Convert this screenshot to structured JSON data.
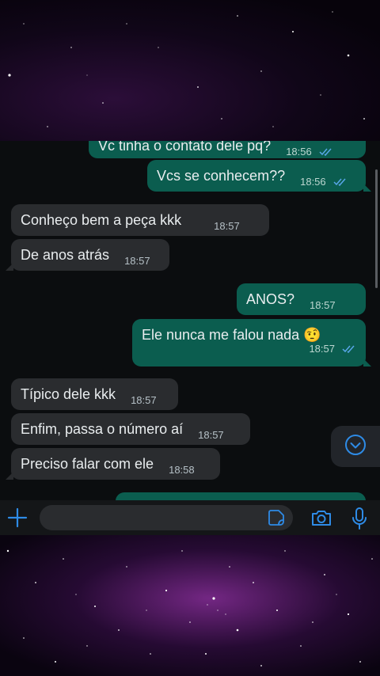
{
  "colors": {
    "incoming_bubble": "#2a2c2f",
    "outgoing_bubble": "#0b5d4f",
    "chat_background": "#0b0d0f",
    "accent": "#2e8be6",
    "read_ticks": "#58a6e8"
  },
  "messages": [
    {
      "direction": "out",
      "text": "Vc tinha o contato dele pq?",
      "time": "18:56",
      "status": "read"
    },
    {
      "direction": "out",
      "text": "Vcs se conhecem??",
      "time": "18:56",
      "status": "read"
    },
    {
      "direction": "in",
      "text": "Conheço bem a peça kkk",
      "time": "18:57"
    },
    {
      "direction": "in",
      "text": "De anos atrás",
      "time": "18:57"
    },
    {
      "direction": "out",
      "text": "ANOS?",
      "time": "18:57",
      "status": "read"
    },
    {
      "direction": "out",
      "text": "Ele nunca me falou nada 🤨",
      "time": "18:57",
      "status": "read"
    },
    {
      "direction": "in",
      "text": "Típico dele kkk",
      "time": "18:57"
    },
    {
      "direction": "in",
      "text": "Enfim, passa o número aí",
      "time": "18:57"
    },
    {
      "direction": "in",
      "text": "Preciso falar com ele",
      "time": "18:58"
    }
  ],
  "composer": {
    "icons": [
      "plus-icon",
      "sticker-icon",
      "camera-icon",
      "microphone-icon"
    ]
  },
  "scroll_button_icon": "chevron-down-circle-icon"
}
